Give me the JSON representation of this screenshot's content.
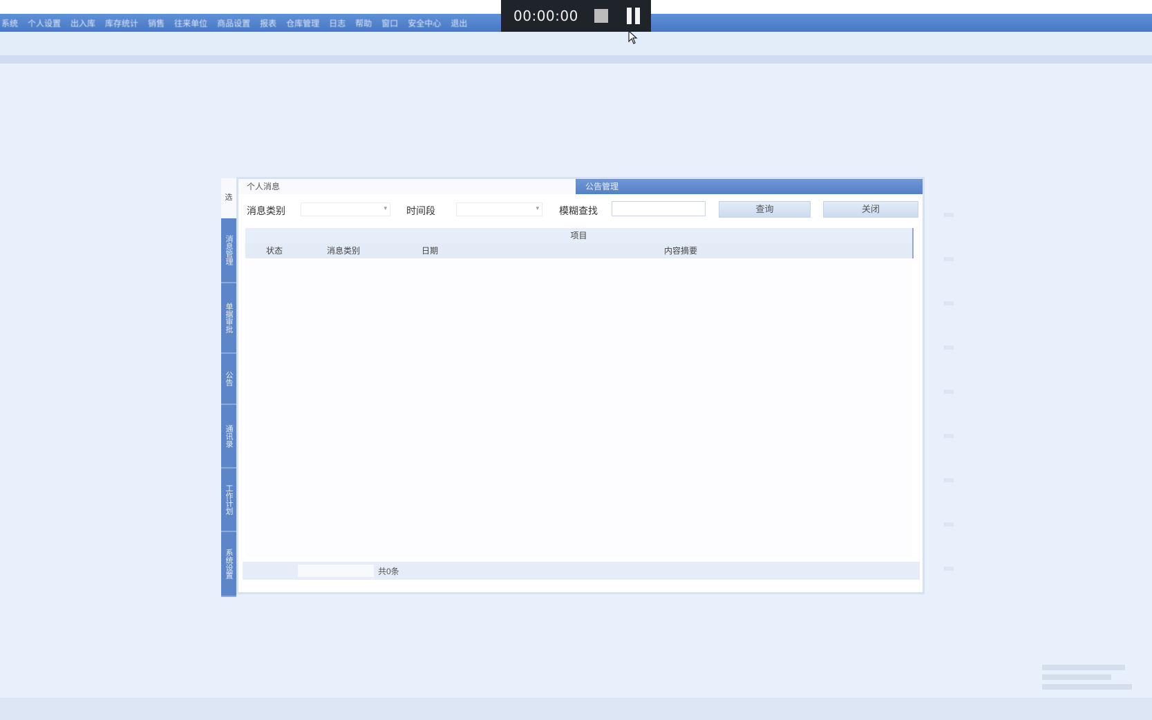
{
  "menu": {
    "items": [
      "系统",
      "个人设置",
      "出入库",
      "库存统计",
      "销售",
      "往来单位",
      "商品设置",
      "报表",
      "仓库管理",
      "日志",
      "帮助",
      "窗口",
      "安全中心",
      "退出"
    ]
  },
  "recorder": {
    "timer": "00:00:00"
  },
  "side_tabs": {
    "handle": "选",
    "items": [
      "消息管理",
      "单据审批",
      "公告",
      "通讯录",
      "工作计划",
      "系统设置"
    ]
  },
  "dialog": {
    "tab_personal": "个人消息",
    "tab_manage": "公告管理"
  },
  "filters": {
    "category_label": "消息类别",
    "period_label": "时间段",
    "search_label": "模糊查找",
    "search_value": "",
    "query_button": "查询",
    "close_button": "关闭"
  },
  "grid": {
    "group_header": "项目",
    "columns": [
      "状态",
      "消息类别",
      "日期",
      "内容摘要"
    ],
    "rows": []
  },
  "footer": {
    "total": "共0条"
  }
}
